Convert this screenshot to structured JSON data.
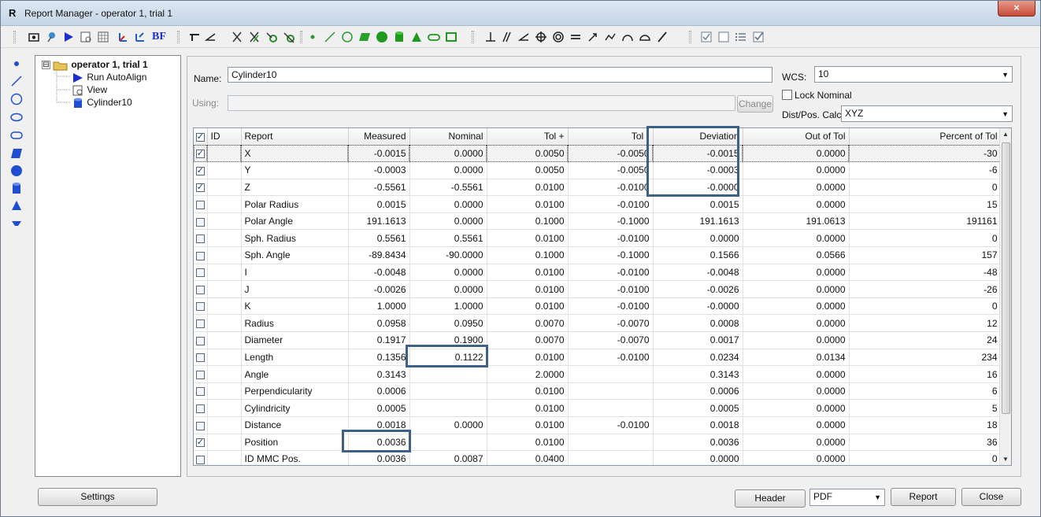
{
  "window": {
    "app_letter": "R",
    "title": "Report Manager - operator 1, trial 1",
    "close": "×"
  },
  "toolbar": {
    "icons": [
      "screenshot-icon",
      "pin-icon",
      "play-icon",
      "report-icon",
      "table-icon",
      "axis-icon",
      "align-icon",
      "best-fit-icon",
      "angle-marker-icon",
      "angle-icon",
      "cross-icon",
      "cross-alt-icon",
      "scan-icon",
      "scan-off-icon",
      "point-icon",
      "line-icon",
      "circle-icon",
      "plane-icon",
      "sphere-icon",
      "cylinder-icon",
      "cone-icon",
      "slot-icon",
      "rectangle-icon",
      "perpendicular-icon",
      "parallel-icon",
      "angle-tol-icon",
      "position-icon",
      "concentric-icon",
      "equal-icon",
      "arrow-icon",
      "profile-icon",
      "arc-icon",
      "dome-icon",
      "slash-icon",
      "check-icon",
      "square-icon",
      "list-icon",
      "checked-doc-icon"
    ],
    "bf_label": "BF"
  },
  "tree": {
    "expander": "⊟",
    "root": "operator 1, trial 1",
    "children": [
      "Run AutoAlign",
      "View",
      "Cylinder10"
    ]
  },
  "form": {
    "name_label": "Name:",
    "name_value": "Cylinder10",
    "using_label": "Using:",
    "using_value": "",
    "change_label": "Change",
    "wcs_label": "WCS:",
    "wcs_value": "10",
    "lock_nominal_label": "Lock Nominal",
    "calc_label": "Dist/Pos. Calc:",
    "calc_value": "XYZ"
  },
  "table": {
    "headers": [
      "ID",
      "Report",
      "Measured",
      "Nominal",
      "Tol +",
      "Tol -",
      "Deviation",
      "Out of Tol",
      "Percent of Tol"
    ],
    "rows": [
      {
        "checked": true,
        "report": "X",
        "measured": "-0.0015",
        "nominal": "0.0000",
        "tolp": "0.0050",
        "tolm": "-0.0050",
        "dev": "-0.0015",
        "oot": "0.0000",
        "pct": "-30"
      },
      {
        "checked": true,
        "report": "Y",
        "measured": "-0.0003",
        "nominal": "0.0000",
        "tolp": "0.0050",
        "tolm": "-0.0050",
        "dev": "-0.0003",
        "oot": "0.0000",
        "pct": "-6"
      },
      {
        "checked": true,
        "report": "Z",
        "measured": "-0.5561",
        "nominal": "-0.5561",
        "tolp": "0.0100",
        "tolm": "-0.0100",
        "dev": "-0.0000",
        "oot": "0.0000",
        "pct": "0"
      },
      {
        "checked": false,
        "report": "Polar Radius",
        "measured": "0.0015",
        "nominal": "0.0000",
        "tolp": "0.0100",
        "tolm": "-0.0100",
        "dev": "0.0015",
        "oot": "0.0000",
        "pct": "15"
      },
      {
        "checked": false,
        "report": "Polar Angle",
        "measured": "191.1613",
        "nominal": "0.0000",
        "tolp": "0.1000",
        "tolm": "-0.1000",
        "dev": "191.1613",
        "oot": "191.0613",
        "pct": "191161"
      },
      {
        "checked": false,
        "report": "Sph. Radius",
        "measured": "0.5561",
        "nominal": "0.5561",
        "tolp": "0.0100",
        "tolm": "-0.0100",
        "dev": "0.0000",
        "oot": "0.0000",
        "pct": "0"
      },
      {
        "checked": false,
        "report": "Sph. Angle",
        "measured": "-89.8434",
        "nominal": "-90.0000",
        "tolp": "0.1000",
        "tolm": "-0.1000",
        "dev": "0.1566",
        "oot": "0.0566",
        "pct": "157"
      },
      {
        "checked": false,
        "report": "I",
        "measured": "-0.0048",
        "nominal": "0.0000",
        "tolp": "0.0100",
        "tolm": "-0.0100",
        "dev": "-0.0048",
        "oot": "0.0000",
        "pct": "-48"
      },
      {
        "checked": false,
        "report": "J",
        "measured": "-0.0026",
        "nominal": "0.0000",
        "tolp": "0.0100",
        "tolm": "-0.0100",
        "dev": "-0.0026",
        "oot": "0.0000",
        "pct": "-26"
      },
      {
        "checked": false,
        "report": "K",
        "measured": "1.0000",
        "nominal": "1.0000",
        "tolp": "0.0100",
        "tolm": "-0.0100",
        "dev": "-0.0000",
        "oot": "0.0000",
        "pct": "0"
      },
      {
        "checked": false,
        "report": "Radius",
        "measured": "0.0958",
        "nominal": "0.0950",
        "tolp": "0.0070",
        "tolm": "-0.0070",
        "dev": "0.0008",
        "oot": "0.0000",
        "pct": "12"
      },
      {
        "checked": false,
        "report": "Diameter",
        "measured": "0.1917",
        "nominal": "0.1900",
        "tolp": "0.0070",
        "tolm": "-0.0070",
        "dev": "0.0017",
        "oot": "0.0000",
        "pct": "24"
      },
      {
        "checked": false,
        "report": "Length",
        "measured": "0.1356",
        "nominal": "0.1122",
        "tolp": "0.0100",
        "tolm": "-0.0100",
        "dev": "0.0234",
        "oot": "0.0134",
        "pct": "234"
      },
      {
        "checked": false,
        "report": "Angle",
        "measured": "0.3143",
        "nominal": "",
        "tolp": "2.0000",
        "tolm": "",
        "dev": "0.3143",
        "oot": "0.0000",
        "pct": "16"
      },
      {
        "checked": false,
        "report": "Perpendicularity",
        "measured": "0.0006",
        "nominal": "",
        "tolp": "0.0100",
        "tolm": "",
        "dev": "0.0006",
        "oot": "0.0000",
        "pct": "6"
      },
      {
        "checked": false,
        "report": "Cylindricity",
        "measured": "0.0005",
        "nominal": "",
        "tolp": "0.0100",
        "tolm": "",
        "dev": "0.0005",
        "oot": "0.0000",
        "pct": "5"
      },
      {
        "checked": false,
        "report": "Distance",
        "measured": "0.0018",
        "nominal": "0.0000",
        "tolp": "0.0100",
        "tolm": "-0.0100",
        "dev": "0.0018",
        "oot": "0.0000",
        "pct": "18"
      },
      {
        "checked": true,
        "report": "Position",
        "measured": "0.0036",
        "nominal": "",
        "tolp": "0.0100",
        "tolm": "",
        "dev": "0.0036",
        "oot": "0.0000",
        "pct": "36"
      },
      {
        "checked": false,
        "report": "ID MMC Pos.",
        "measured": "0.0036",
        "nominal": "0.0087",
        "tolp": "0.0400",
        "tolm": "",
        "dev": "0.0000",
        "oot": "0.0000",
        "pct": "0"
      }
    ]
  },
  "buttons": {
    "settings": "Settings",
    "header": "Header",
    "format_value": "PDF",
    "report": "Report",
    "close": "Close"
  },
  "colors": {
    "highlight_box": "#3d6089",
    "accent": "#1f5fcf"
  }
}
